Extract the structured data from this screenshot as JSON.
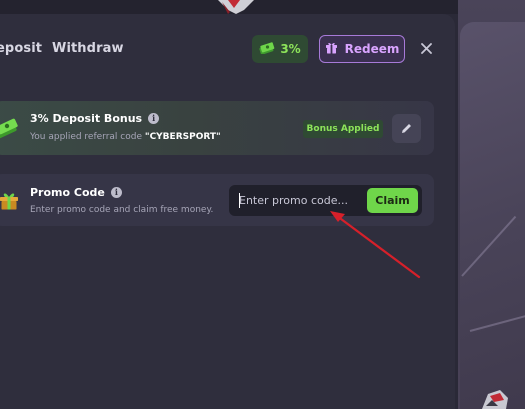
{
  "header": {
    "tabs": [
      {
        "label": "eposit"
      },
      {
        "label": "Withdraw"
      }
    ],
    "bonus_badge": "3%",
    "redeem_label": "Redeem"
  },
  "deposit_bonus": {
    "title": "3% Deposit Bonus",
    "subtitle_prefix": "You applied referral code",
    "referral_code": "\"CYBERSPORT\"",
    "status": "Bonus Applied"
  },
  "promo": {
    "title": "Promo Code",
    "subtitle": "Enter promo code and claim free money.",
    "placeholder": "Enter promo code...",
    "value": "",
    "claim_label": "Claim"
  },
  "icons": {
    "bonus_badge": "cash-icon",
    "redeem": "gift-icon",
    "close": "close-icon",
    "deposit_bonus": "cash-stack-icon",
    "promo": "gift-box-icon",
    "edit": "pencil-icon",
    "info": "info-icon"
  },
  "colors": {
    "accent_green": "#6fd64a",
    "accent_purple": "#a77ad8",
    "annotation_arrow": "#d6202a"
  }
}
